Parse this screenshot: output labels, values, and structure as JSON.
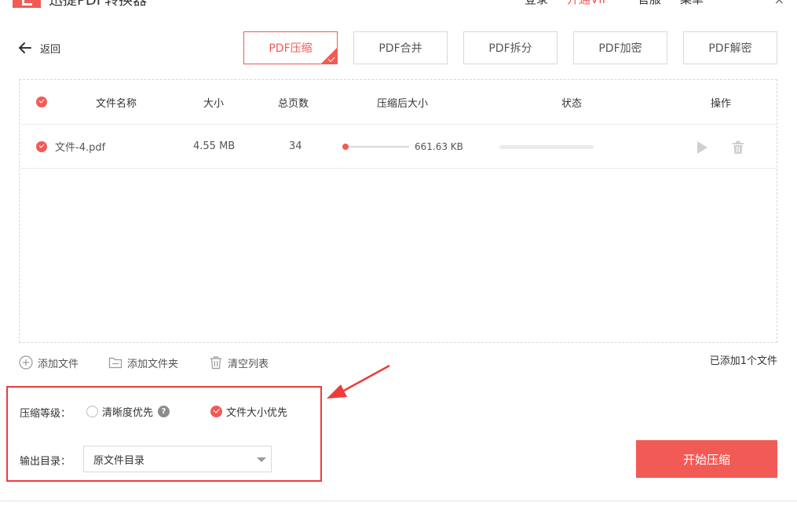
{
  "colors": {
    "accent": "#f25a55",
    "annotation": "#ee3b3b"
  },
  "titlebar": {
    "title": "迅捷PDF转换器",
    "menu": [
      "登录",
      "开通VIP",
      "官服",
      "菜单"
    ],
    "close_glyph": "×"
  },
  "back": {
    "label": "返回"
  },
  "tabs": [
    {
      "label": "PDF压缩",
      "active": true
    },
    {
      "label": "PDF合并"
    },
    {
      "label": "PDF拆分"
    },
    {
      "label": "PDF加密"
    },
    {
      "label": "PDF解密"
    }
  ],
  "table": {
    "headers": {
      "name": "文件名称",
      "size": "大小",
      "pages": "总页数",
      "compressed": "压缩后大小",
      "status": "状态",
      "actions": "操作"
    },
    "rows": [
      {
        "name": "文件-4.pdf",
        "size": "4.55 MB",
        "pages": "34",
        "compressed": "661.63 KB",
        "progress": 0
      }
    ]
  },
  "actions": {
    "add_file": "添加文件",
    "add_folder": "添加文件夹",
    "clear_list": "清空列表"
  },
  "file_count": "已添加1个文件",
  "settings": {
    "level_label": "压缩等级：",
    "option_clarity": "清晰度优先",
    "option_size": "文件大小优先",
    "help_glyph": "?",
    "output_label": "输出目录：",
    "output_value": "原文件目录"
  },
  "start_button": "开始压缩"
}
